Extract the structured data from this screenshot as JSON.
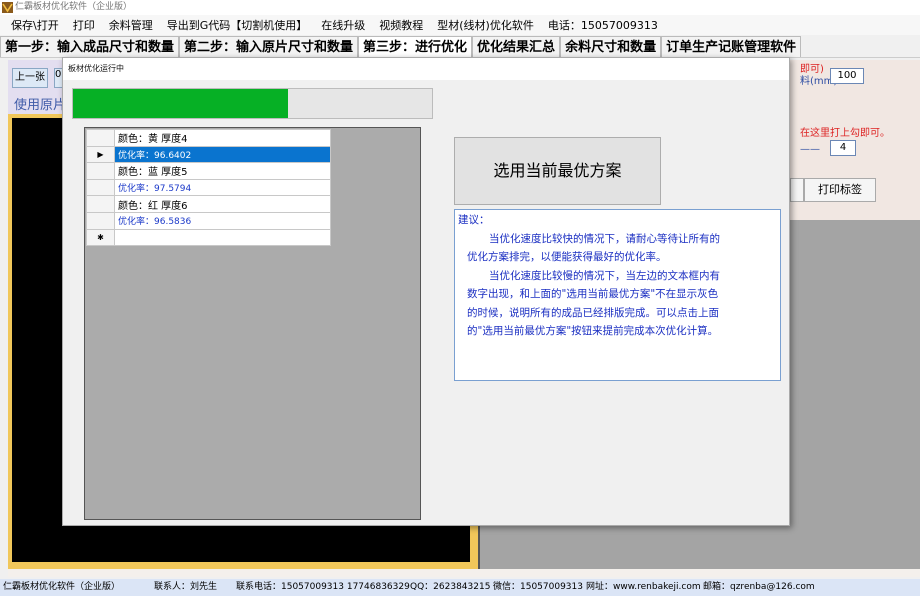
{
  "window": {
    "title": "仁霸板材优化软件（企业版）"
  },
  "menu": [
    "保存\\打开",
    "打印",
    "余料管理",
    "导出到G代码【切割机使用】",
    "在线升级",
    "视频教程",
    "型材(线材)优化软件",
    "电话：15057009313"
  ],
  "tabs": [
    "第一步：输入成品尺寸和数量",
    "第二步：输入原片尺寸和数量",
    "第三步：进行优化",
    "优化结果汇总",
    "余料尺寸和数量",
    "订单生产记账管理软件"
  ],
  "active_tab": 2,
  "background": {
    "prev_button": "上一张",
    "prev_button2": "0",
    "use_label": "使用原片",
    "right_red": "即可)",
    "right_mm": "料(mm)",
    "right_input1": "100",
    "right_hint": "在这里打上勾即可。",
    "right_dash": "——",
    "right_input2": "4",
    "print_label": "打印标签"
  },
  "dialog": {
    "title": "板材优化运行中",
    "progress_fraction": 0.6,
    "rows": [
      {
        "marker": "",
        "text": "颜色：黄    厚度4",
        "kind": "header"
      },
      {
        "marker": "▶",
        "text": "优化率：96.6402",
        "kind": "rate",
        "selected": true
      },
      {
        "marker": "",
        "text": "颜色：蓝    厚度5",
        "kind": "header"
      },
      {
        "marker": "",
        "text": "优化率：97.5794",
        "kind": "rate"
      },
      {
        "marker": "",
        "text": "颜色：红    厚度6",
        "kind": "header"
      },
      {
        "marker": "",
        "text": "优化率：96.5836",
        "kind": "rate"
      },
      {
        "marker": "✱",
        "text": "",
        "kind": "new"
      }
    ],
    "best_button": "选用当前最优方案",
    "advice": {
      "title": "建议：",
      "lines": [
        "当优化速度比较快的情况下，请耐心等待让所有的",
        "优化方案排完，以便能获得最好的优化率。",
        "当优化速度比较慢的情况下，当左边的文本框内有",
        "数字出现，和上面的\"选用当前最优方案\"不在显示灰色",
        "的时候，说明所有的成品已经排版完成。可以点击上面",
        "的\"选用当前最优方案\"按钮来提前完成本次优化计算。"
      ]
    }
  },
  "status": {
    "app": "仁霸板材优化软件（企业版）",
    "contact": "联系人：刘先生",
    "phone": "联系电话：15057009313 17746836329",
    "qq": "QQ：2623843215",
    "wechat": "微信：15057009313",
    "site": "网址：www.renbakeji.com",
    "email": "邮箱：qzrenba@126.com"
  }
}
